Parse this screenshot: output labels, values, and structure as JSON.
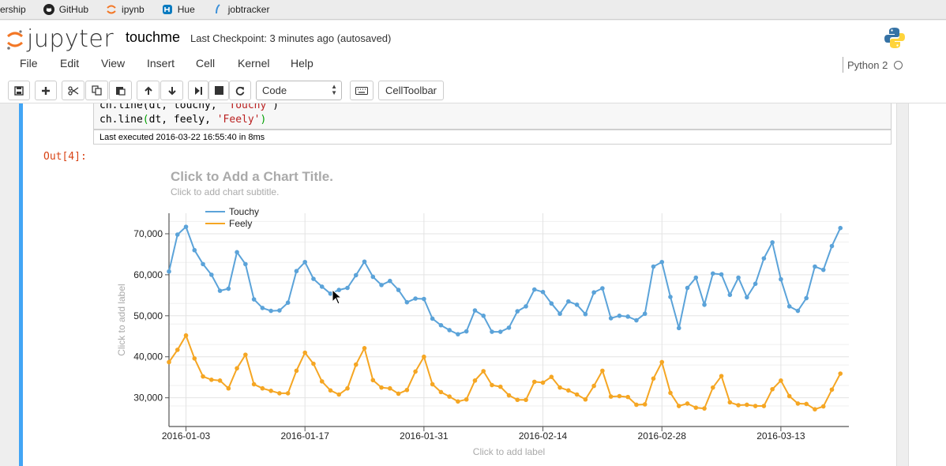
{
  "bookmarks": [
    {
      "label": "ership",
      "icon": "none"
    },
    {
      "label": "GitHub",
      "icon": "github-icon"
    },
    {
      "label": "ipynb",
      "icon": "jupyter-icon"
    },
    {
      "label": "Hue",
      "icon": "hue-icon"
    },
    {
      "label": "jobtracker",
      "icon": "feather-icon"
    }
  ],
  "header": {
    "logo_text": "jupyter",
    "notebook_name": "touchme",
    "checkpoint": "Last Checkpoint: 3 minutes ago (autosaved)",
    "kernel_name": "Python 2"
  },
  "menu": [
    "File",
    "Edit",
    "View",
    "Insert",
    "Cell",
    "Kernel",
    "Help"
  ],
  "toolbar": {
    "cell_type": "Code",
    "celltoolbar_label": "CellToolbar",
    "buttons": [
      "save-icon",
      "plus-icon",
      "cut-icon",
      "copy-icon",
      "paste-icon",
      "arrow-up-icon",
      "arrow-down-icon",
      "step-forward-icon",
      "stop-icon",
      "refresh-icon",
      "keyboard-icon"
    ]
  },
  "cell": {
    "code_line1_a": "ch.line(dt, touchy, ",
    "code_line1_b": "'Touchy'",
    "code_line1_c": ")",
    "code_line2_a": "ch.line",
    "code_line2_b": "(",
    "code_line2_c": "dt, feely, ",
    "code_line2_d": "'Feely'",
    "code_line2_e": ")",
    "last_executed": "Last executed 2016-03-22 16:55:40 in 8ms",
    "out_prompt": "Out[4]:"
  },
  "chart_data": {
    "type": "line",
    "title": "Click to Add a Chart Title.",
    "subtitle": "Click to add chart subtitle.",
    "xlabel": "Click to add label",
    "ylabel": "Click to add label",
    "ylim": [
      23000,
      75000
    ],
    "yticks": [
      30000,
      40000,
      50000,
      60000,
      70000
    ],
    "ytick_labels": [
      "30,000",
      "40,000",
      "50,000",
      "60,000",
      "70,000"
    ],
    "xtick_labels": [
      "2016-01-03",
      "2016-01-17",
      "2016-01-31",
      "2016-02-14",
      "2016-02-28",
      "2016-03-13"
    ],
    "x_start": "2016-01-01",
    "x_end": "2016-03-21",
    "legend_position": "top-left",
    "grid": true,
    "series": [
      {
        "name": "Touchy",
        "color": "#5ba3d9",
        "values": [
          60800,
          69800,
          71700,
          66000,
          62600,
          60000,
          56100,
          56600,
          65500,
          62600,
          54000,
          51900,
          51200,
          51300,
          53200,
          60900,
          63100,
          59000,
          57100,
          55400,
          56300,
          56800,
          59900,
          63200,
          59500,
          57500,
          58500,
          56300,
          53300,
          54200,
          54100,
          49300,
          47700,
          46500,
          45500,
          46200,
          51300,
          50000,
          46100,
          46100,
          47100,
          51100,
          52300,
          56400,
          55800,
          53000,
          50500,
          53500,
          52700,
          50400,
          55700,
          56700,
          49400,
          50000,
          49800,
          48900,
          50500,
          62000,
          63100,
          54600,
          47000,
          56800,
          59300,
          52700,
          60300,
          60100,
          55100,
          59300,
          54500,
          57800,
          64000,
          67900,
          58900,
          52300,
          51200,
          54300,
          62000,
          61200,
          67000,
          71400
        ]
      },
      {
        "name": "Feely",
        "color": "#f5a623",
        "values": [
          38700,
          41700,
          45200,
          39600,
          35200,
          34400,
          34200,
          32300,
          37200,
          40500,
          33300,
          32300,
          31700,
          31100,
          31100,
          36600,
          41000,
          38300,
          34000,
          31800,
          30800,
          32300,
          38100,
          42100,
          34300,
          32500,
          32300,
          31000,
          31900,
          36400,
          40000,
          33300,
          31400,
          30300,
          29100,
          29600,
          34200,
          36500,
          33100,
          32700,
          30600,
          29500,
          29500,
          33900,
          33700,
          35100,
          32500,
          31800,
          30800,
          29600,
          32900,
          36600,
          30300,
          30400,
          30200,
          28300,
          28400,
          34700,
          38700,
          31200,
          28000,
          28600,
          27600,
          27400,
          32500,
          35300,
          28900,
          28200,
          28300,
          28000,
          28000,
          32100,
          34200,
          30400,
          28600,
          28500,
          27200,
          27900,
          32000,
          35900
        ]
      }
    ]
  }
}
